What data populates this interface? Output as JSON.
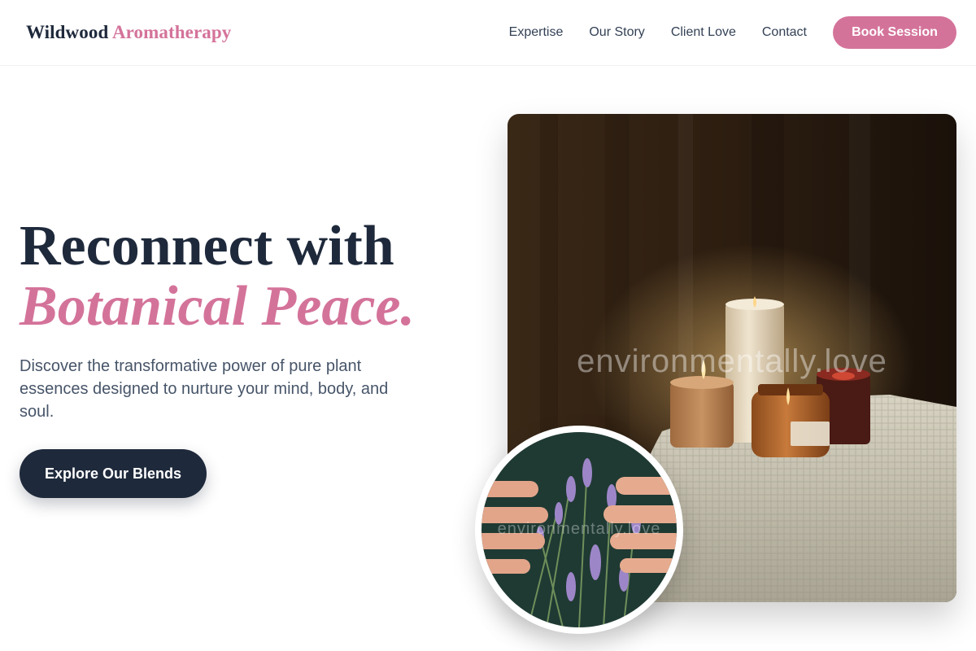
{
  "brand": {
    "part1": "Wildwood",
    "part2": "Aromatherapy"
  },
  "nav": {
    "items": [
      {
        "label": "Expertise"
      },
      {
        "label": "Our Story"
      },
      {
        "label": "Client Love"
      },
      {
        "label": "Contact"
      }
    ],
    "cta_label": "Book Session"
  },
  "hero": {
    "title_line1": "Reconnect with",
    "title_line2": "Botanical Peace.",
    "description": "Discover the transformative power of pure plant essences designed to nurture your mind, body, and soul.",
    "button_label": "Explore Our Blends"
  },
  "images": {
    "main_watermark": "environmentally.love",
    "round_watermark": "environmentally.love"
  },
  "colors": {
    "accent": "#d4739a",
    "dark": "#1e293b",
    "text_muted": "#475569"
  }
}
